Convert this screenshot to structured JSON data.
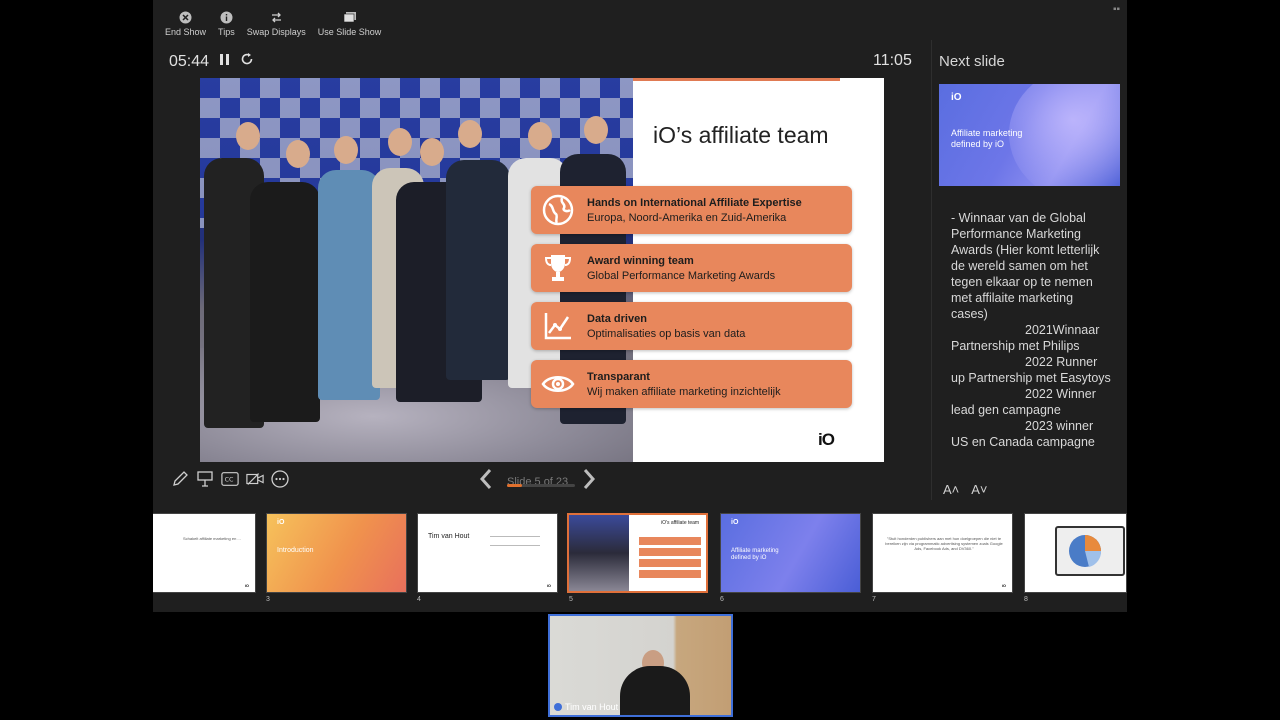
{
  "toolbar": {
    "end_show": "End Show",
    "tips": "Tips",
    "swap_displays": "Swap Displays",
    "use_slide_show": "Use Slide Show"
  },
  "timer": {
    "elapsed": "05:44"
  },
  "clock": "11:05",
  "next_slide_label": "Next slide",
  "current_slide": {
    "title": "iO’s affiliate team",
    "logo": "iO",
    "cards": [
      {
        "title": "Hands on International Affiliate Expertise",
        "subtitle": "Europa, Noord-Amerika en Zuid-Amerika",
        "icon": "globe-icon"
      },
      {
        "title": "Award winning team",
        "subtitle": "Global Performance Marketing Awards",
        "icon": "trophy-icon"
      },
      {
        "title": "Data driven",
        "subtitle": "Optimalisaties op basis van data",
        "icon": "chart-icon"
      },
      {
        "title": "Transparant",
        "subtitle": "Wij maken affiliate marketing inzichtelijk",
        "icon": "eye-icon"
      }
    ]
  },
  "next_slide": {
    "logo": "iO",
    "text": "Affiliate marketing defined by iO"
  },
  "notes": {
    "lines": [
      "- Winnaar van de Global Performance Marketing Awards (Hier komt letterlijk de wereld samen om het tegen elkaar op te nemen met affilaite marketing cases)",
      "2021Winnaar",
      "Partnership met Philips",
      "2022 Runner",
      "up Partnership met Easytoys",
      "2022 Winner",
      "lead gen campagne",
      "2023 winner",
      "US en Canada campagne"
    ]
  },
  "font_buttons": {
    "increase": "A˄",
    "decrease": "A˅"
  },
  "navigation": {
    "counter": "Slide 5 of 23",
    "progress": 0.22
  },
  "thumbnails": [
    {
      "num": "",
      "text": "Schakelt affiliate marketing en ..."
    },
    {
      "num": "3",
      "text": "Introduction"
    },
    {
      "num": "4",
      "text": "Tim van Hout"
    },
    {
      "num": "5",
      "text": "iO's affiliate team"
    },
    {
      "num": "6",
      "text": "Affiliate marketing defined by iO"
    },
    {
      "num": "7",
      "text": "\"Stuit honderden publishers aan met hun doelgroepen die niet te bereiken zijn via programmatic advertising systemen zoals Google Ads, Facebook Ads, and DV360.\""
    },
    {
      "num": "8",
      "text": ""
    }
  ],
  "webcam": {
    "name": "Tim van Hout"
  },
  "colors": {
    "accent": "#e0702d",
    "card": "#e8875c",
    "webcam_border": "#3f6fd8"
  }
}
